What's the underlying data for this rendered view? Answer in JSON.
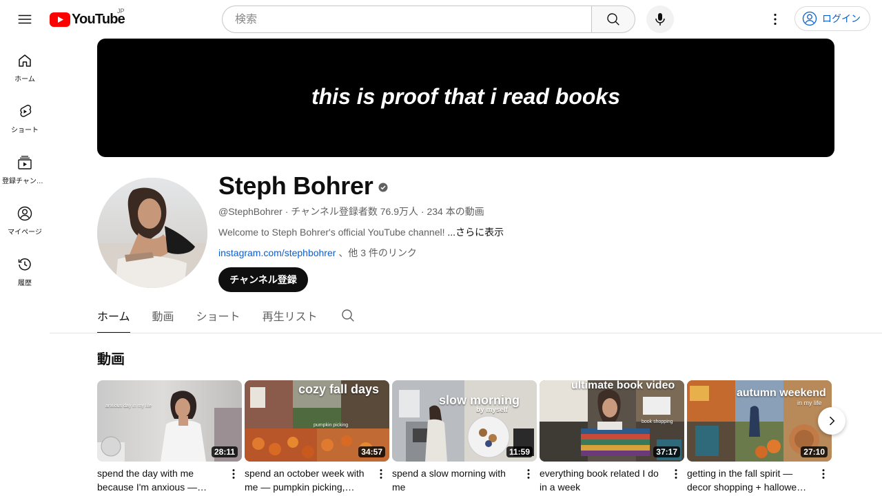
{
  "masthead": {
    "logo_text": "YouTube",
    "region": "JP",
    "search_placeholder": "検索",
    "login_label": "ログイン"
  },
  "guide": {
    "items": [
      {
        "label": "ホーム",
        "icon": "home-icon"
      },
      {
        "label": "ショート",
        "icon": "shorts-icon"
      },
      {
        "label": "登録チャンネル",
        "icon": "subscriptions-icon"
      },
      {
        "label": "マイページ",
        "icon": "you-icon"
      },
      {
        "label": "履歴",
        "icon": "history-icon"
      }
    ]
  },
  "channel": {
    "banner_text": "this is proof that i read books",
    "name": "Steph Bohrer",
    "handle": "@StephBohrer",
    "subscribers": "チャンネル登録者数 76.9万人",
    "video_count": "234 本の動画",
    "description": "Welcome to Steph Bohrer's official YouTube channel! ",
    "more_label": "...さらに表示",
    "link_text": "instagram.com/stephbohrer",
    "other_links": "、他 3 件のリンク",
    "subscribe_label": "チャンネル登録"
  },
  "tabs": [
    {
      "label": "ホーム",
      "active": true
    },
    {
      "label": "動画",
      "active": false
    },
    {
      "label": "ショート",
      "active": false
    },
    {
      "label": "再生リスト",
      "active": false
    }
  ],
  "section": {
    "title": "動画"
  },
  "videos": [
    {
      "title": "spend the day with me because I'm anxious — doing things to feel better",
      "duration": "28:11",
      "thumb_text": "",
      "thumb_small": "anxious day in my life"
    },
    {
      "title": "spend an october week with me — pumpkin picking, decorating & more",
      "duration": "34:57",
      "thumb_text": "cozy fall days",
      "thumb_small": "pumpkin picking"
    },
    {
      "title": "spend a slow morning with me",
      "duration": "11:59",
      "thumb_text": "slow morning",
      "thumb_small": "by myself"
    },
    {
      "title": "everything book related I do in a week",
      "duration": "37:17",
      "thumb_text": "ultimate book video",
      "thumb_small": "book shopping"
    },
    {
      "title": "getting in the fall spirit — decor shopping + halloween prep",
      "duration": "27:10",
      "thumb_text": "autumn weekend",
      "thumb_small": "in my life"
    }
  ]
}
